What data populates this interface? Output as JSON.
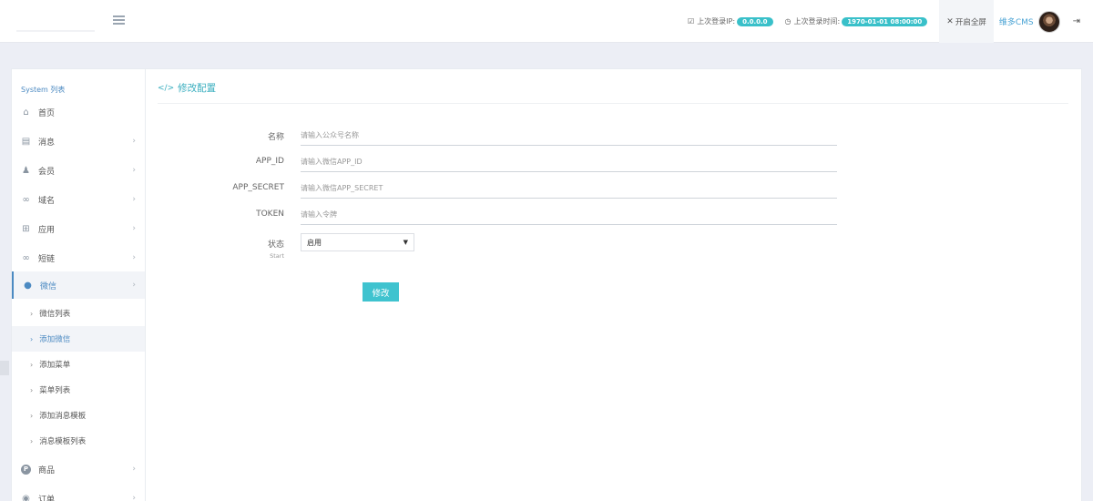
{
  "header": {
    "last_ip_label": "上次登录IP:",
    "last_ip_value": "0.0.0.0",
    "last_time_label": "上次登录时间:",
    "last_time_value": "1970-01-01 08:00:00",
    "fullscreen_label": "开启全屏",
    "user_name": "维多CMS",
    "icons": {
      "menu": "list-icon",
      "ip": "checkbox-icon",
      "time": "clock-icon",
      "fullscreen": "expand-icon",
      "logout": "logout-icon"
    }
  },
  "sidebar": {
    "title": "System 列表",
    "items": [
      {
        "label": "首页",
        "icon": "home-icon"
      },
      {
        "label": "消息",
        "icon": "document-icon"
      },
      {
        "label": "会员",
        "icon": "user-icon"
      },
      {
        "label": "域名",
        "icon": "link-icon"
      },
      {
        "label": "应用",
        "icon": "gift-icon"
      },
      {
        "label": "短链",
        "icon": "link-icon"
      },
      {
        "label": "微信",
        "icon": "wechat-icon"
      }
    ],
    "sub_items": [
      "微信列表",
      "添加微信",
      "添加菜单",
      "菜单列表",
      "添加消息模板",
      "消息模板列表"
    ],
    "more_items": [
      {
        "label": "商品",
        "icon": "p-icon",
        "glyph": "P"
      },
      {
        "label": "订单",
        "icon": "order-icon"
      }
    ]
  },
  "main": {
    "title": "修改配置",
    "fields": [
      {
        "label": "名称",
        "placeholder": "请输入公众号名称"
      },
      {
        "label": "APP_ID",
        "placeholder": "请输入微信APP_ID"
      },
      {
        "label": "APP_SECRET",
        "placeholder": "请输入微信APP_SECRET"
      },
      {
        "label": "TOKEN",
        "placeholder": "请输入令牌"
      }
    ],
    "status": {
      "label": "状态",
      "sub_label": "Start",
      "selected": "启用"
    },
    "submit_label": "修改"
  },
  "colors": {
    "accent": "#3fc3cf",
    "link": "#4c8ac2",
    "badge": "#39c0c9"
  }
}
